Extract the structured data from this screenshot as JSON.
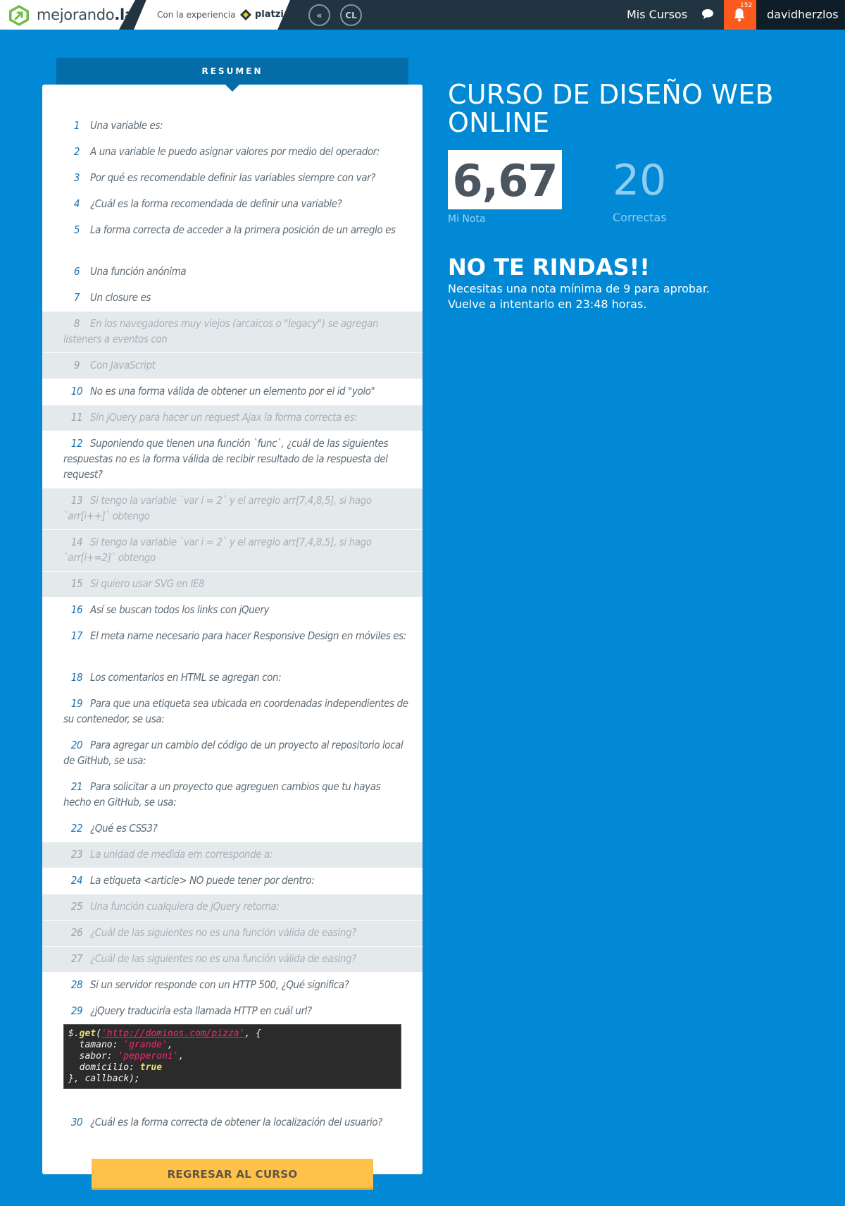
{
  "nav": {
    "brand_prefix": "mejorando",
    "brand_suffix": ".la",
    "experience_label": "Con la experiencia",
    "partner_name": "platzi",
    "circle_buttons": [
      "«",
      "CL"
    ],
    "my_courses": "Mis Cursos",
    "notification_count": "152",
    "username": "davidherzlos"
  },
  "summary": {
    "tab_label": "RESUMEN",
    "questions": [
      {
        "num": "1",
        "text": "Una variable es:",
        "status": "correct"
      },
      {
        "num": "2",
        "text": "A una variable le puedo asignar valores por medio del operador:",
        "status": "correct"
      },
      {
        "num": "3",
        "text": "Por qué es recomendable definir las variables siempre con var?",
        "status": "correct"
      },
      {
        "num": "4",
        "text": "¿Cuál es la forma recomendada de definir una variable?",
        "status": "correct"
      },
      {
        "num": "5",
        "text": "La forma correcta de acceder a la primera posición de un arreglo es",
        "status": "correct"
      },
      {
        "num": "6",
        "text": "Una función anónima",
        "status": "correct"
      },
      {
        "num": "7",
        "text": "Un closure es",
        "status": "correct"
      },
      {
        "num": "8",
        "text": "En los navegadores muy viejos (arcaicos o \"legacy\") se agregan listeners a eventos con",
        "status": "wrong"
      },
      {
        "num": "9",
        "text": "Con JavaScript",
        "status": "wrong"
      },
      {
        "num": "10",
        "text": "No es una forma válida de obtener un elemento por el id \"yolo\"",
        "status": "correct"
      },
      {
        "num": "11",
        "text": "Sin jQuery para hacer un request Ajax la forma correcta es:",
        "status": "wrong"
      },
      {
        "num": "12",
        "text": "Suponiendo que tienen una función `func`, ¿cuál de las siguientes respuestas no es la forma válida de recibir resultado de la respuesta del request?",
        "status": "correct"
      },
      {
        "num": "13",
        "text": "Si tengo la variable `var i = 2` y el arreglo arr[7,4,8,5], si hago `arr[i++]` obtengo",
        "status": "wrong"
      },
      {
        "num": "14",
        "text": "Si tengo la variable `var i = 2` y el arreglo arr[7,4,8,5], si hago `arr[i+=2]` obtengo",
        "status": "wrong"
      },
      {
        "num": "15",
        "text": "Si quiero usar SVG en IE8",
        "status": "wrong"
      },
      {
        "num": "16",
        "text": "Así se buscan todos los links con jQuery",
        "status": "correct"
      },
      {
        "num": "17",
        "text": "El meta name necesario para hacer Responsive Design en móviles es:",
        "status": "correct"
      },
      {
        "num": "18",
        "text": "Los comentarios en HTML se agregan con:",
        "status": "correct"
      },
      {
        "num": "19",
        "text": "Para que una etiqueta sea ubicada en coordenadas independientes de su contenedor, se usa:",
        "status": "correct"
      },
      {
        "num": "20",
        "text": "Para agregar un cambio del código de un proyecto al repositorio local de GitHub, se usa:",
        "status": "correct"
      },
      {
        "num": "21",
        "text": "Para solicitar a un proyecto que agreguen cambios que tu hayas hecho en GitHub, se usa:",
        "status": "correct"
      },
      {
        "num": "22",
        "text": "¿Qué es CSS3?",
        "status": "correct"
      },
      {
        "num": "23",
        "text": "La unidad de medida em corresponde a:",
        "status": "wrong"
      },
      {
        "num": "24",
        "text": "La etiqueta <article> NO puede tener por dentro:",
        "status": "correct"
      },
      {
        "num": "25",
        "text": "Una función cualquiera de jQuery retorna:",
        "status": "wrong"
      },
      {
        "num": "26",
        "text": "¿Cuál de las siguientes no es una función válida de easing?",
        "status": "wrong"
      },
      {
        "num": "27",
        "text": "¿Cuál de las siguientes no es una función válida de easing?",
        "status": "wrong"
      },
      {
        "num": "28",
        "text": "Si un servidor responde con un HTTP 500, ¿Qué significa?",
        "status": "correct"
      },
      {
        "num": "29",
        "text": "¿jQuery traduciría esta llamada HTTP en cuál url?",
        "status": "correct"
      },
      {
        "num": "30",
        "text": "¿Cuál es la forma correcta de obtener la localización del usuario?",
        "status": "correct"
      }
    ],
    "code_snippet": {
      "l1_a": "$.",
      "l1_fn": "get",
      "l1_b": "(",
      "l1_url": "'http://dominos.com/pizza'",
      "l1_c": ", {",
      "l2_key": "  tamano: ",
      "l2_val": "'grande'",
      "l2_end": ",",
      "l3_key": "  sabor: ",
      "l3_val": "'pepperoni'",
      "l3_end": ",",
      "l4_key": "  domicilio: ",
      "l4_val": "true",
      "l5": "}, callback);"
    },
    "back_button": "REGRESAR AL CURSO"
  },
  "result": {
    "course_title": "CURSO DE DISEÑO WEB ONLINE",
    "grade": "6,67",
    "grade_label": "Mi Nota",
    "correct_count": "20",
    "correct_label": "Correctas",
    "fail_title": "NO TE RINDAS!!",
    "fail_line1": "Necesitas una nota mínima de 9 para aprobar.",
    "fail_line2": "Vuelve a intentarlo en 23:48 horas."
  },
  "colors": {
    "background": "#0189d6",
    "topbar": "#213442",
    "notification": "#fb5a1f",
    "wrong_row": "#e4e9ec",
    "button": "#fec24b"
  }
}
